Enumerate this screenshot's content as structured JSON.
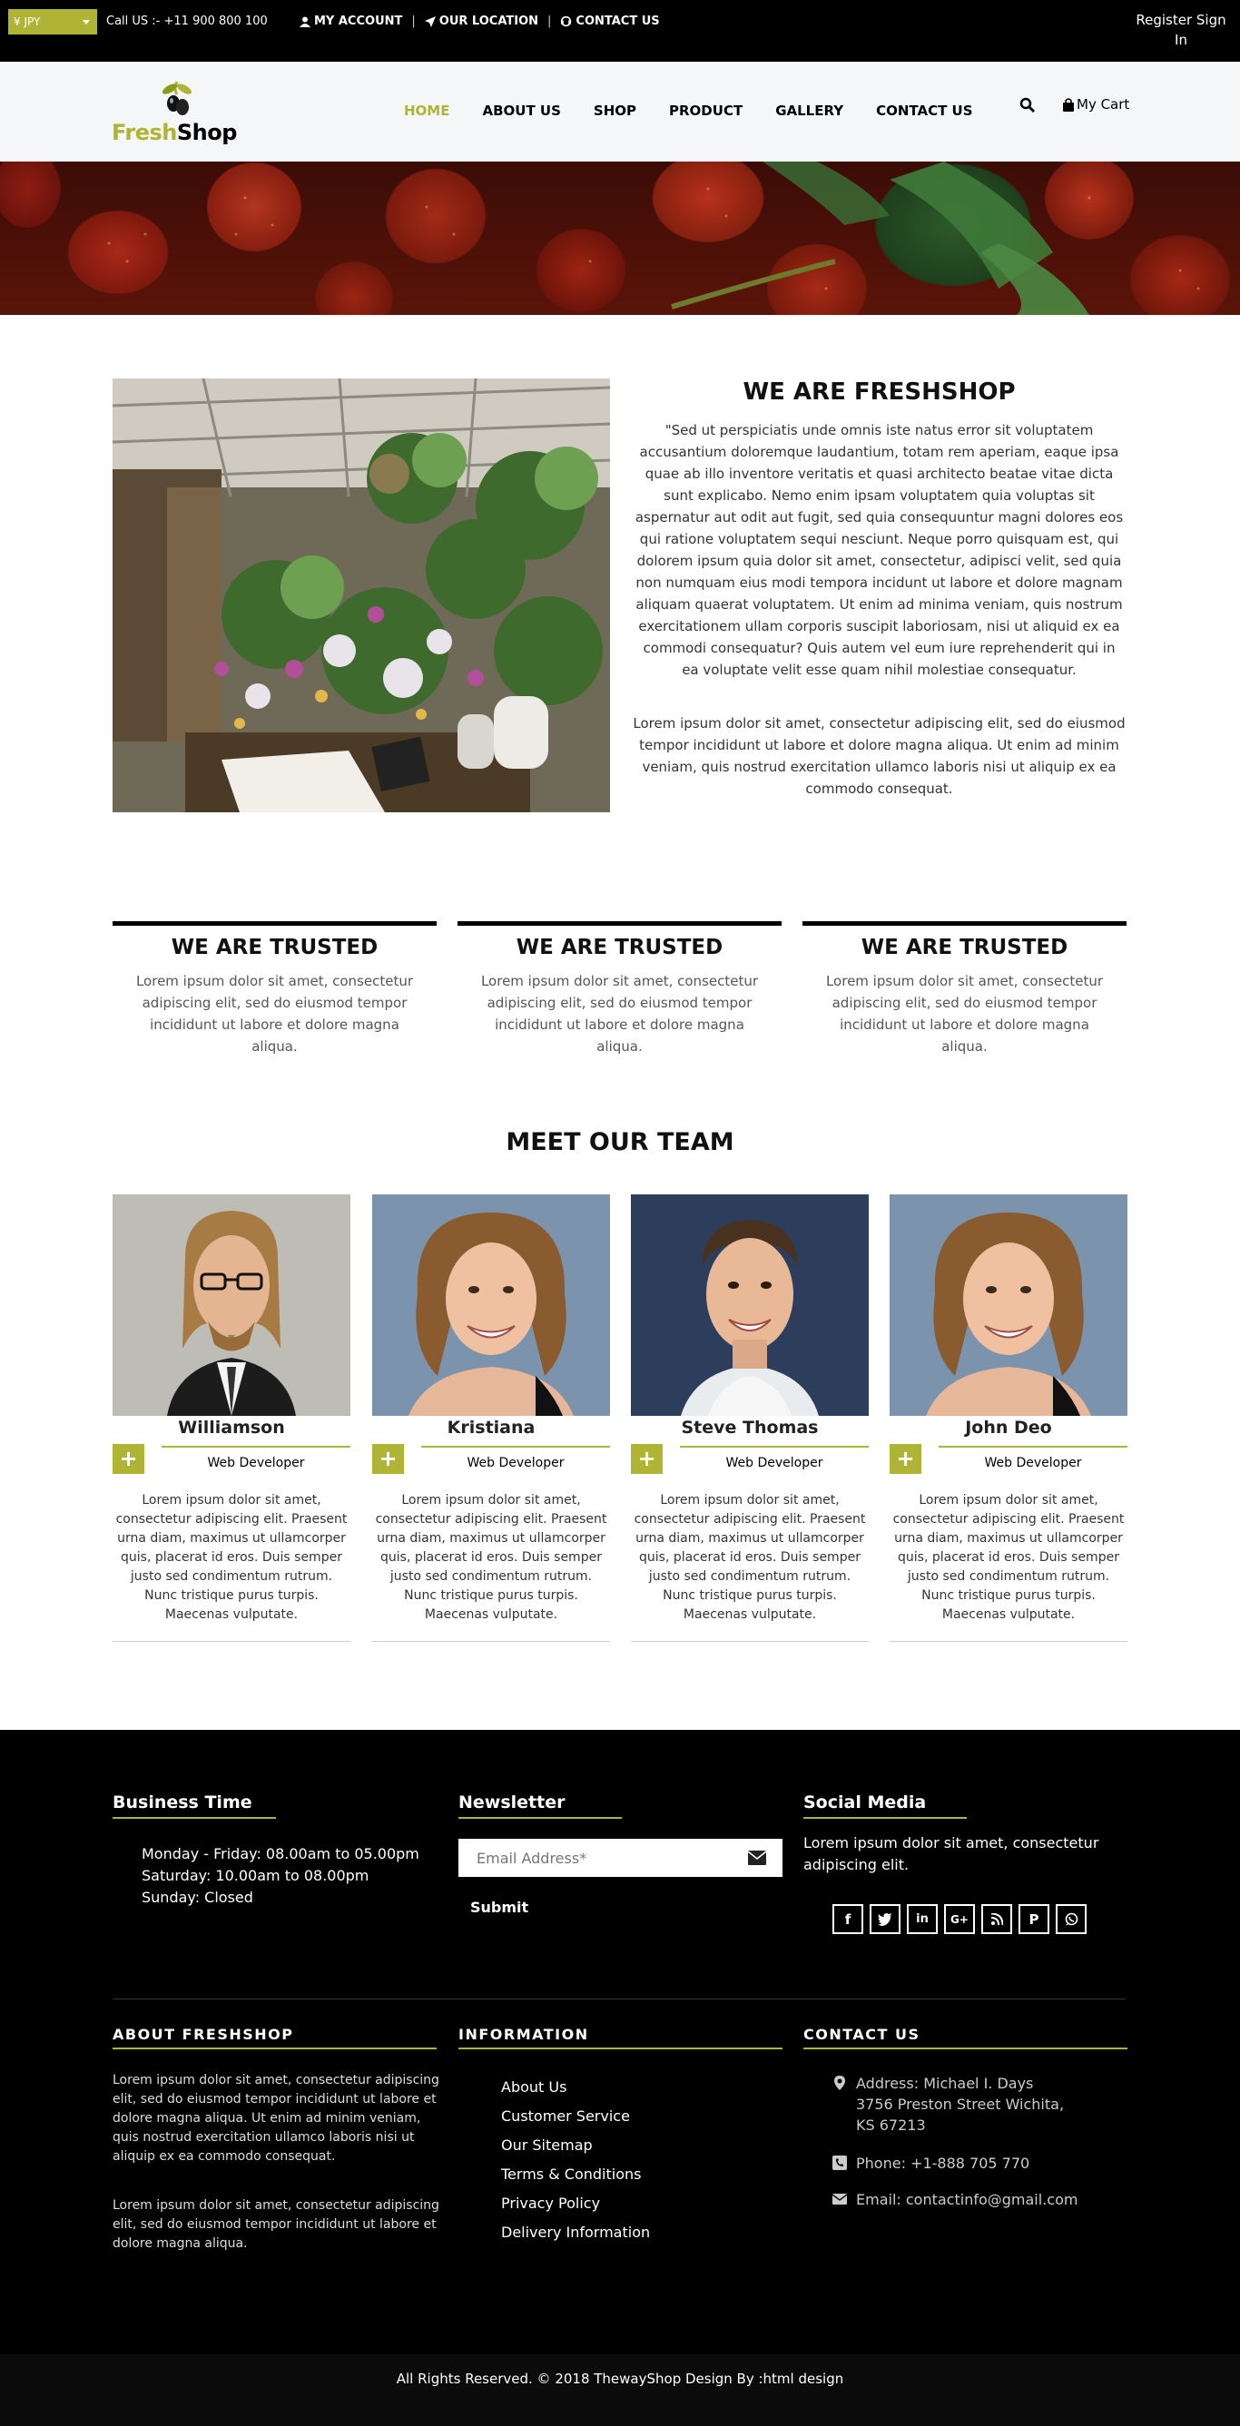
{
  "topbar": {
    "currency": "¥ JPY",
    "call_us": "Call US :- +11 900 800 100",
    "links": [
      "MY ACCOUNT",
      "OUR LOCATION",
      "CONTACT US"
    ],
    "register": "Register",
    "sign_in": "Sign In"
  },
  "brand": {
    "fresh": "Fresh",
    "shop": "Shop"
  },
  "nav": {
    "items": [
      "HOME",
      "ABOUT US",
      "SHOP",
      "PRODUCT",
      "GALLERY",
      "CONTACT US"
    ],
    "cart": "My Cart"
  },
  "about": {
    "title": "WE ARE FRESHSHOP",
    "p1": "\"Sed ut perspiciatis unde omnis iste natus error sit voluptatem accusantium doloremque laudantium, totam rem aperiam, eaque ipsa quae ab illo inventore veritatis et quasi architecto beatae vitae dicta sunt explicabo. Nemo enim ipsam voluptatem quia voluptas sit aspernatur aut odit aut fugit, sed quia consequuntur magni dolores eos qui ratione voluptatem sequi nesciunt. Neque porro quisquam est, qui dolorem ipsum quia dolor sit amet, consectetur, adipisci velit, sed quia non numquam eius modi tempora incidunt ut labore et dolore magnam aliquam quaerat voluptatem. Ut enim ad minima veniam, quis nostrum exercitationem ullam corporis suscipit laboriosam, nisi ut aliquid ex ea commodi consequatur? Quis autem vel eum iure reprehenderit qui in ea voluptate velit esse quam nihil molestiae consequatur.",
    "p2": "Lorem ipsum dolor sit amet, consectetur adipiscing elit, sed do eiusmod tempor incididunt ut labore et dolore magna aliqua. Ut enim ad minim veniam, quis nostrud exercitation ullamco laboris nisi ut aliquip ex ea commodo consequat."
  },
  "trusted": [
    {
      "title": "WE ARE TRUSTED",
      "text": "Lorem ipsum dolor sit amet, consectetur adipiscing elit, sed do eiusmod tempor incididunt ut labore et dolore magna aliqua."
    },
    {
      "title": "WE ARE TRUSTED",
      "text": "Lorem ipsum dolor sit amet, consectetur adipiscing elit, sed do eiusmod tempor incididunt ut labore et dolore magna aliqua."
    },
    {
      "title": "WE ARE TRUSTED",
      "text": "Lorem ipsum dolor sit amet, consectetur adipiscing elit, sed do eiusmod tempor incididunt ut labore et dolore magna aliqua."
    }
  ],
  "team": {
    "title": "MEET OUR TEAM",
    "members": [
      {
        "name": "Williamson",
        "role": "Web Developer",
        "plus": "+",
        "bio": "Lorem ipsum dolor sit amet, consectetur adipiscing elit. Praesent urna diam, maximus ut ullamcorper quis, placerat id eros. Duis semper justo sed condimentum rutrum. Nunc tristique purus turpis. Maecenas vulputate."
      },
      {
        "name": "Kristiana",
        "role": "Web Developer",
        "plus": "+",
        "bio": "Lorem ipsum dolor sit amet, consectetur adipiscing elit. Praesent urna diam, maximus ut ullamcorper quis, placerat id eros. Duis semper justo sed condimentum rutrum. Nunc tristique purus turpis. Maecenas vulputate."
      },
      {
        "name": "Steve Thomas",
        "role": "Web Developer",
        "plus": "+",
        "bio": "Lorem ipsum dolor sit amet, consectetur adipiscing elit. Praesent urna diam, maximus ut ullamcorper quis, placerat id eros. Duis semper justo sed condimentum rutrum. Nunc tristique purus turpis. Maecenas vulputate."
      },
      {
        "name": "John Deo",
        "role": "Web Developer",
        "plus": "+",
        "bio": "Lorem ipsum dolor sit amet, consectetur adipiscing elit. Praesent urna diam, maximus ut ullamcorper quis, placerat id eros. Duis semper justo sed condimentum rutrum. Nunc tristique purus turpis. Maecenas vulputate."
      }
    ]
  },
  "footer": {
    "business_title": "Business Time",
    "hours": [
      "Monday - Friday: 08.00am to 05.00pm",
      "Saturday: 10.00am to 08.00pm",
      "Sunday: Closed"
    ],
    "newsletter_title": "Newsletter",
    "email_placeholder": "Email Address*",
    "submit": "Submit",
    "social_title": "Social Media",
    "social_text": "Lorem ipsum dolor sit amet, consectetur adipiscing elit.",
    "social_icons": [
      "facebook-icon",
      "twitter-icon",
      "linkedin-icon",
      "google-plus-icon",
      "rss-icon",
      "pinterest-icon",
      "whatsapp-icon"
    ],
    "about_title": "ABOUT FRESHSHOP",
    "about_p1": "Lorem ipsum dolor sit amet, consectetur adipiscing elit, sed do eiusmod tempor incididunt ut labore et dolore magna aliqua. Ut enim ad minim veniam, quis nostrud exercitation ullamco laboris nisi ut aliquip ex ea commodo consequat.",
    "about_p2": "Lorem ipsum dolor sit amet, consectetur adipiscing elit, sed do eiusmod tempor incididunt ut labore et dolore magna aliqua.",
    "info_title": "INFORMATION",
    "info_links": [
      "About Us",
      "Customer Service",
      "Our Sitemap",
      "Terms & Conditions",
      "Privacy Policy",
      "Delivery Information"
    ],
    "contact_title": "CONTACT US",
    "address": "Address: Michael I. Days 3756 Preston Street Wichita, KS 67213",
    "phone": "Phone: +1-888 705 770",
    "email": "Email: contactinfo@gmail.com",
    "copyright": "All Rights Reserved. © 2018 ThewayShop Design By :html design"
  },
  "colors": {
    "accent": "#b0b435",
    "topbar": "#000000",
    "footer": "#000000"
  }
}
